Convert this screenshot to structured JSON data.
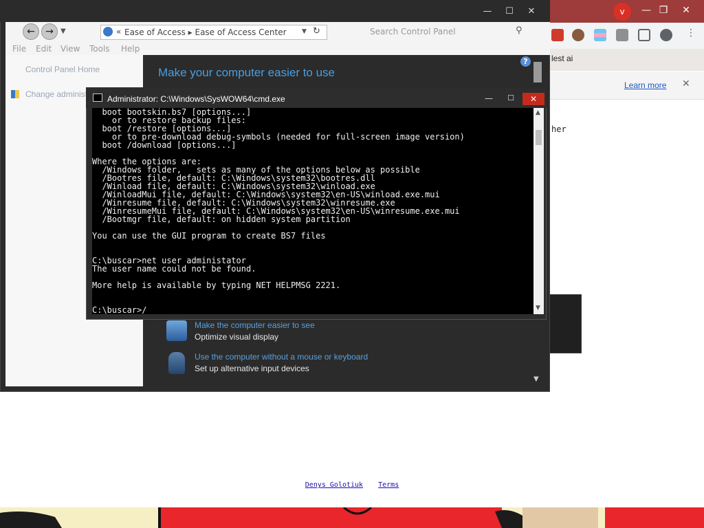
{
  "chrome": {
    "partial_tab_text": "lest ai",
    "learn_more": "Learn more",
    "close_glyph": "✕",
    "partial_text": "her",
    "profile_badge": "v",
    "window_controls": [
      "—",
      "❐",
      "✕"
    ]
  },
  "explorer": {
    "controls": [
      "—",
      "☐",
      "✕"
    ],
    "back": "←",
    "forward": "→",
    "address_prefix": "«",
    "address_path": "Ease of Access  ▸  Ease of Access Center",
    "search_placeholder": "Search Control Panel",
    "menu": [
      "File",
      "Edit",
      "View",
      "Tools",
      "Help"
    ],
    "left_pane": {
      "home": "Control Panel Home",
      "change_admin": "Change administ"
    },
    "heading": "Make your computer easier to use",
    "items": [
      {
        "link": "Make the computer easier to see",
        "sub": "Optimize visual display"
      },
      {
        "link": "Use the computer without a mouse or keyboard",
        "sub": "Set up alternative input devices"
      }
    ],
    "help_glyph": "?"
  },
  "cmd": {
    "title": "Administrator: C:\\Windows\\SysWOW64\\cmd.exe",
    "controls": [
      "—",
      "☐",
      "✕"
    ],
    "lines": [
      "  boot bootskin.bs7 [options...]",
      "    or to restore backup files:",
      "  boot /restore [options...]",
      "    or to pre-download debug-symbols (needed for full-screen image version)",
      "  boot /download [options...]",
      "",
      "Where the options are:",
      "  /Windows folder,   sets as many of the options below as possible",
      "  /Bootres file, default: C:\\Windows\\system32\\bootres.dll",
      "  /Winload file, default: C:\\Windows\\system32\\winload.exe",
      "  /WinloadMui file, default: C:\\Windows\\system32\\en-US\\winload.exe.mui",
      "  /Winresume file, default: C:\\Windows\\system32\\winresume.exe",
      "  /WinresumeMui file, default: C:\\Windows\\system32\\en-US\\winresume.exe.mui",
      "  /Bootmgr file, default: on hidden system partition",
      "",
      "You can use the GUI program to create BS7 files",
      "",
      "",
      "C:\\buscar>net user administator",
      "The user name could not be found.",
      "",
      "More help is available by typing NET HELPMSG 2221.",
      "",
      "",
      "C:\\buscar>/"
    ]
  },
  "footer": {
    "author": "Denys Golotiuk",
    "terms": "Terms"
  },
  "colors": {
    "chrome_titlebar": "#9e3b3b",
    "explorer_dark": "#2b2b2b",
    "link_blue": "#5aa0dd",
    "cmd_close": "#c42b1c"
  }
}
